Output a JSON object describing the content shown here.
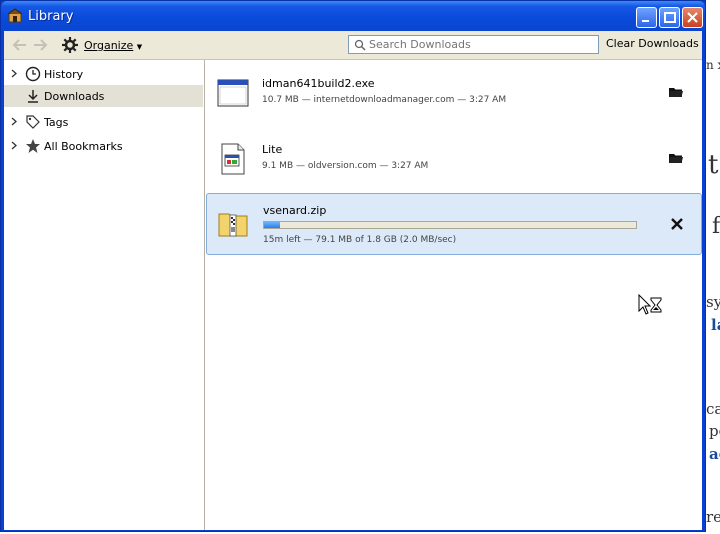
{
  "window": {
    "title": "Library"
  },
  "toolbar": {
    "organize_label": "Organize",
    "search_placeholder": "Search Downloads",
    "clear_label": "Clear Downloads"
  },
  "sidebar": {
    "items": [
      {
        "label": "History",
        "icon": "clock-icon",
        "expandable": true,
        "selected": false
      },
      {
        "label": "Downloads",
        "icon": "download-arrow-icon",
        "expandable": false,
        "selected": true
      },
      {
        "label": "Tags",
        "icon": "tag-icon",
        "expandable": true,
        "selected": false
      },
      {
        "label": "All Bookmarks",
        "icon": "star-icon",
        "expandable": true,
        "selected": false
      }
    ]
  },
  "downloads": [
    {
      "name": "idman641build2.exe",
      "meta": "10.7 MB — internetdownloadmanager.com — 3:27 AM",
      "icon": "exe-file-icon",
      "action": "folder-icon"
    },
    {
      "name": "Lite",
      "meta": "9.1 MB — oldversion.com — 3:27 AM",
      "icon": "app-file-icon",
      "action": "folder-icon"
    },
    {
      "name": "vsenard.zip",
      "meta": "15m left — 79.1 MB of 1.8 GB (2.0 MB/sec)",
      "icon": "zip-file-icon",
      "action": "cancel-icon",
      "progress": 0.043
    }
  ],
  "background_page": {
    "fragments": [
      "n x",
      "t",
      "c",
      "f",
      "sy",
      "la",
      "ca",
      "pe",
      "ac",
      "re"
    ]
  },
  "colors": {
    "titlebar": "#0a4bdc",
    "selected_row": "#dce9f8",
    "progress": "#2a7de4"
  }
}
